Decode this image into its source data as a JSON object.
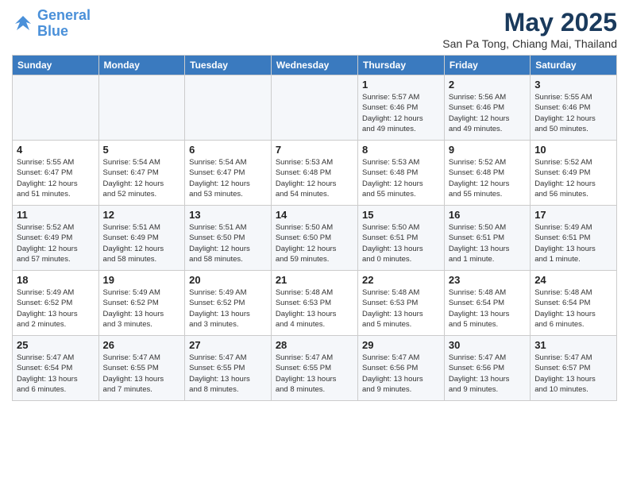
{
  "header": {
    "logo_line1": "General",
    "logo_line2": "Blue",
    "month": "May 2025",
    "location": "San Pa Tong, Chiang Mai, Thailand"
  },
  "weekdays": [
    "Sunday",
    "Monday",
    "Tuesday",
    "Wednesday",
    "Thursday",
    "Friday",
    "Saturday"
  ],
  "weeks": [
    [
      {
        "day": "",
        "info": ""
      },
      {
        "day": "",
        "info": ""
      },
      {
        "day": "",
        "info": ""
      },
      {
        "day": "",
        "info": ""
      },
      {
        "day": "1",
        "info": "Sunrise: 5:57 AM\nSunset: 6:46 PM\nDaylight: 12 hours\nand 49 minutes."
      },
      {
        "day": "2",
        "info": "Sunrise: 5:56 AM\nSunset: 6:46 PM\nDaylight: 12 hours\nand 49 minutes."
      },
      {
        "day": "3",
        "info": "Sunrise: 5:55 AM\nSunset: 6:46 PM\nDaylight: 12 hours\nand 50 minutes."
      }
    ],
    [
      {
        "day": "4",
        "info": "Sunrise: 5:55 AM\nSunset: 6:47 PM\nDaylight: 12 hours\nand 51 minutes."
      },
      {
        "day": "5",
        "info": "Sunrise: 5:54 AM\nSunset: 6:47 PM\nDaylight: 12 hours\nand 52 minutes."
      },
      {
        "day": "6",
        "info": "Sunrise: 5:54 AM\nSunset: 6:47 PM\nDaylight: 12 hours\nand 53 minutes."
      },
      {
        "day": "7",
        "info": "Sunrise: 5:53 AM\nSunset: 6:48 PM\nDaylight: 12 hours\nand 54 minutes."
      },
      {
        "day": "8",
        "info": "Sunrise: 5:53 AM\nSunset: 6:48 PM\nDaylight: 12 hours\nand 55 minutes."
      },
      {
        "day": "9",
        "info": "Sunrise: 5:52 AM\nSunset: 6:48 PM\nDaylight: 12 hours\nand 55 minutes."
      },
      {
        "day": "10",
        "info": "Sunrise: 5:52 AM\nSunset: 6:49 PM\nDaylight: 12 hours\nand 56 minutes."
      }
    ],
    [
      {
        "day": "11",
        "info": "Sunrise: 5:52 AM\nSunset: 6:49 PM\nDaylight: 12 hours\nand 57 minutes."
      },
      {
        "day": "12",
        "info": "Sunrise: 5:51 AM\nSunset: 6:49 PM\nDaylight: 12 hours\nand 58 minutes."
      },
      {
        "day": "13",
        "info": "Sunrise: 5:51 AM\nSunset: 6:50 PM\nDaylight: 12 hours\nand 58 minutes."
      },
      {
        "day": "14",
        "info": "Sunrise: 5:50 AM\nSunset: 6:50 PM\nDaylight: 12 hours\nand 59 minutes."
      },
      {
        "day": "15",
        "info": "Sunrise: 5:50 AM\nSunset: 6:51 PM\nDaylight: 13 hours\nand 0 minutes."
      },
      {
        "day": "16",
        "info": "Sunrise: 5:50 AM\nSunset: 6:51 PM\nDaylight: 13 hours\nand 1 minute."
      },
      {
        "day": "17",
        "info": "Sunrise: 5:49 AM\nSunset: 6:51 PM\nDaylight: 13 hours\nand 1 minute."
      }
    ],
    [
      {
        "day": "18",
        "info": "Sunrise: 5:49 AM\nSunset: 6:52 PM\nDaylight: 13 hours\nand 2 minutes."
      },
      {
        "day": "19",
        "info": "Sunrise: 5:49 AM\nSunset: 6:52 PM\nDaylight: 13 hours\nand 3 minutes."
      },
      {
        "day": "20",
        "info": "Sunrise: 5:49 AM\nSunset: 6:52 PM\nDaylight: 13 hours\nand 3 minutes."
      },
      {
        "day": "21",
        "info": "Sunrise: 5:48 AM\nSunset: 6:53 PM\nDaylight: 13 hours\nand 4 minutes."
      },
      {
        "day": "22",
        "info": "Sunrise: 5:48 AM\nSunset: 6:53 PM\nDaylight: 13 hours\nand 5 minutes."
      },
      {
        "day": "23",
        "info": "Sunrise: 5:48 AM\nSunset: 6:54 PM\nDaylight: 13 hours\nand 5 minutes."
      },
      {
        "day": "24",
        "info": "Sunrise: 5:48 AM\nSunset: 6:54 PM\nDaylight: 13 hours\nand 6 minutes."
      }
    ],
    [
      {
        "day": "25",
        "info": "Sunrise: 5:47 AM\nSunset: 6:54 PM\nDaylight: 13 hours\nand 6 minutes."
      },
      {
        "day": "26",
        "info": "Sunrise: 5:47 AM\nSunset: 6:55 PM\nDaylight: 13 hours\nand 7 minutes."
      },
      {
        "day": "27",
        "info": "Sunrise: 5:47 AM\nSunset: 6:55 PM\nDaylight: 13 hours\nand 8 minutes."
      },
      {
        "day": "28",
        "info": "Sunrise: 5:47 AM\nSunset: 6:55 PM\nDaylight: 13 hours\nand 8 minutes."
      },
      {
        "day": "29",
        "info": "Sunrise: 5:47 AM\nSunset: 6:56 PM\nDaylight: 13 hours\nand 9 minutes."
      },
      {
        "day": "30",
        "info": "Sunrise: 5:47 AM\nSunset: 6:56 PM\nDaylight: 13 hours\nand 9 minutes."
      },
      {
        "day": "31",
        "info": "Sunrise: 5:47 AM\nSunset: 6:57 PM\nDaylight: 13 hours\nand 10 minutes."
      }
    ]
  ]
}
